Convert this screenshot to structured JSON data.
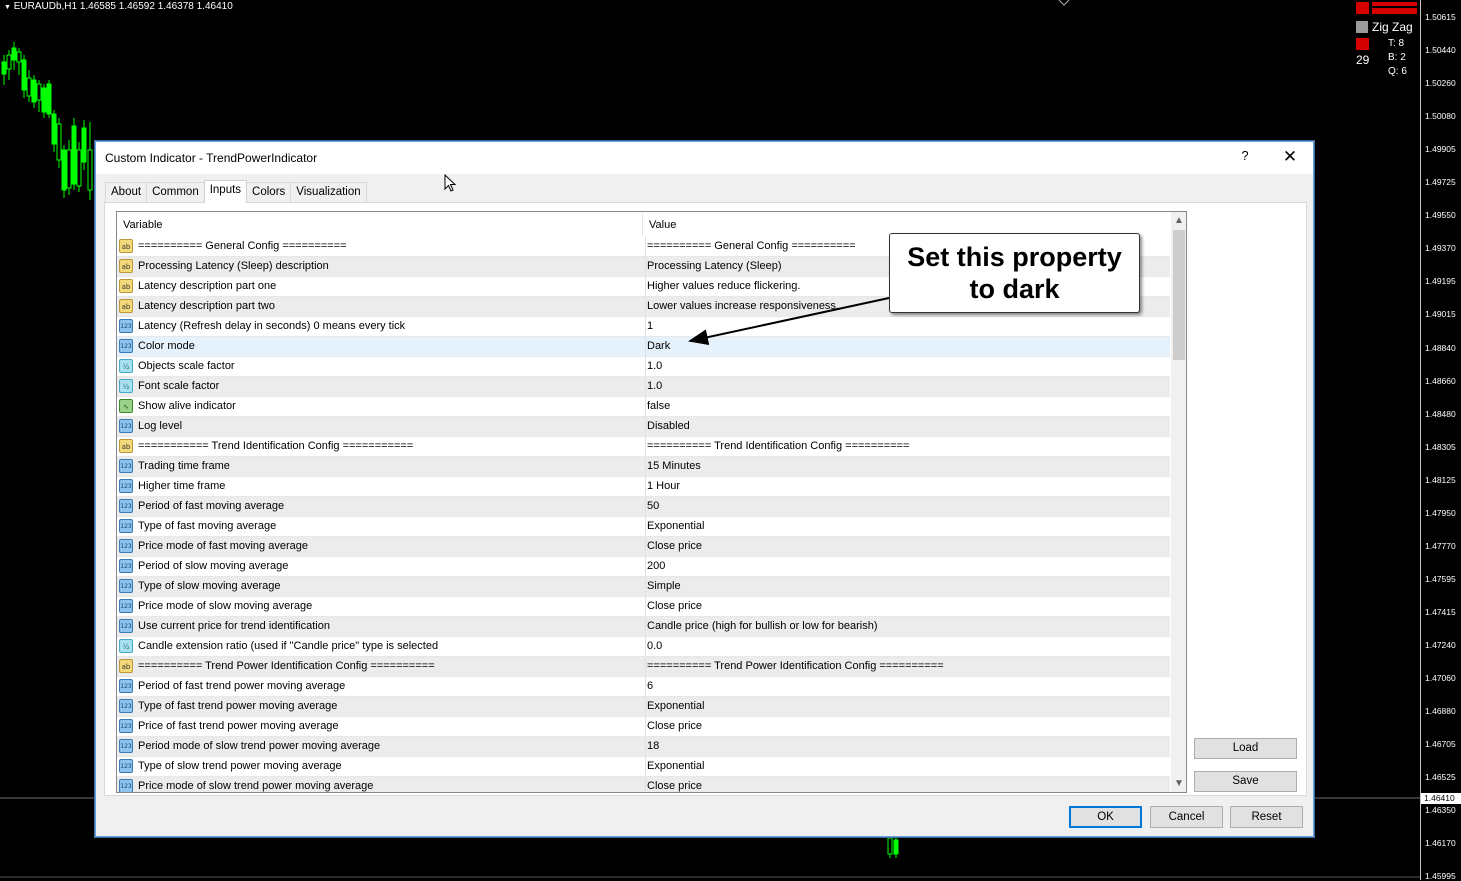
{
  "chart": {
    "title": "EURAUDb,H1  1.46585 1.46592 1.46378 1.46410",
    "current_price": "1.46410",
    "price_levels": [
      "1.50615",
      "1.50440",
      "1.50260",
      "1.50080",
      "1.49905",
      "1.49725",
      "1.49550",
      "1.49370",
      "1.49195",
      "1.49015",
      "1.48840",
      "1.48660",
      "1.48480",
      "1.48305",
      "1.48125",
      "1.47950",
      "1.47770",
      "1.47595",
      "1.47415",
      "1.47240",
      "1.47060",
      "1.46880",
      "1.46705",
      "1.46525",
      "1.46350",
      "1.46170",
      "1.45995"
    ],
    "indicator_name": "Zig Zag",
    "stat_number": "29",
    "stat_t": "T:  8",
    "stat_b": "B:  2",
    "stat_q": "Q:  6",
    "colors": {
      "background": "#000000",
      "candle": "#00ff00",
      "axis_text": "#ffffff"
    }
  },
  "dialog": {
    "title": "Custom Indicator - TrendPowerIndicator",
    "help_label": "?",
    "close_label": "✕",
    "tabs": [
      "About",
      "Common",
      "Inputs",
      "Colors",
      "Visualization"
    ],
    "active_tab": "Inputs",
    "columns": {
      "variable": "Variable",
      "value": "Value"
    },
    "rows": [
      {
        "icon": "ab",
        "variable": "========== General Config ==========",
        "value": "========== General Config =========="
      },
      {
        "icon": "ab",
        "variable": "Processing Latency (Sleep) description",
        "value": "Processing Latency (Sleep)"
      },
      {
        "icon": "ab",
        "variable": "Latency description part one",
        "value": "Higher values reduce flickering."
      },
      {
        "icon": "ab",
        "variable": "Latency description part two",
        "value": "Lower values increase responsiveness."
      },
      {
        "icon": "123",
        "variable": "Latency (Refresh delay in seconds) 0 means every tick",
        "value": "1"
      },
      {
        "icon": "123",
        "variable": "Color mode",
        "value": "Dark"
      },
      {
        "icon": "frac",
        "variable": "Objects scale factor",
        "value": "1.0"
      },
      {
        "icon": "frac",
        "variable": "Font scale factor",
        "value": "1.0"
      },
      {
        "icon": "bool",
        "variable": "Show alive indicator",
        "value": "false"
      },
      {
        "icon": "123",
        "variable": "Log level",
        "value": "Disabled"
      },
      {
        "icon": "ab",
        "variable": "=========== Trend Identification Config ===========",
        "value": "========== Trend Identification Config =========="
      },
      {
        "icon": "123",
        "variable": "Trading time frame",
        "value": "15 Minutes"
      },
      {
        "icon": "123",
        "variable": "Higher time frame",
        "value": "1 Hour"
      },
      {
        "icon": "123",
        "variable": "Period of fast moving average",
        "value": "50"
      },
      {
        "icon": "123",
        "variable": "Type of fast moving average",
        "value": "Exponential"
      },
      {
        "icon": "123",
        "variable": "Price mode of fast moving average",
        "value": "Close price"
      },
      {
        "icon": "123",
        "variable": "Period of slow moving average",
        "value": "200"
      },
      {
        "icon": "123",
        "variable": "Type of slow moving average",
        "value": "Simple"
      },
      {
        "icon": "123",
        "variable": "Price mode of slow moving average",
        "value": "Close price"
      },
      {
        "icon": "123",
        "variable": "Use current price for trend identification",
        "value": "Candle price (high for bullish or low for bearish)"
      },
      {
        "icon": "frac",
        "variable": "Candle extension ratio (used if \"Candle price\" type is selected",
        "value": "0.0"
      },
      {
        "icon": "ab",
        "variable": "========== Trend Power Identification Config ==========",
        "value": "========== Trend Power Identification Config =========="
      },
      {
        "icon": "123",
        "variable": "Period of fast trend power moving average",
        "value": "6"
      },
      {
        "icon": "123",
        "variable": "Type of fast trend power moving average",
        "value": "Exponential"
      },
      {
        "icon": "123",
        "variable": "Price of fast trend power moving average",
        "value": "Close price"
      },
      {
        "icon": "123",
        "variable": "Period mode of slow trend power moving average",
        "value": "18"
      },
      {
        "icon": "123",
        "variable": "Type of slow trend power moving average",
        "value": "Exponential"
      },
      {
        "icon": "123",
        "variable": "Price mode of slow trend power moving average",
        "value": "Close price"
      }
    ],
    "selected_row": 5,
    "side_buttons": {
      "load": "Load",
      "save": "Save"
    },
    "footer_buttons": {
      "ok": "OK",
      "cancel": "Cancel",
      "reset": "Reset"
    }
  },
  "callout": {
    "line1": "Set this property",
    "line2": "to dark"
  }
}
